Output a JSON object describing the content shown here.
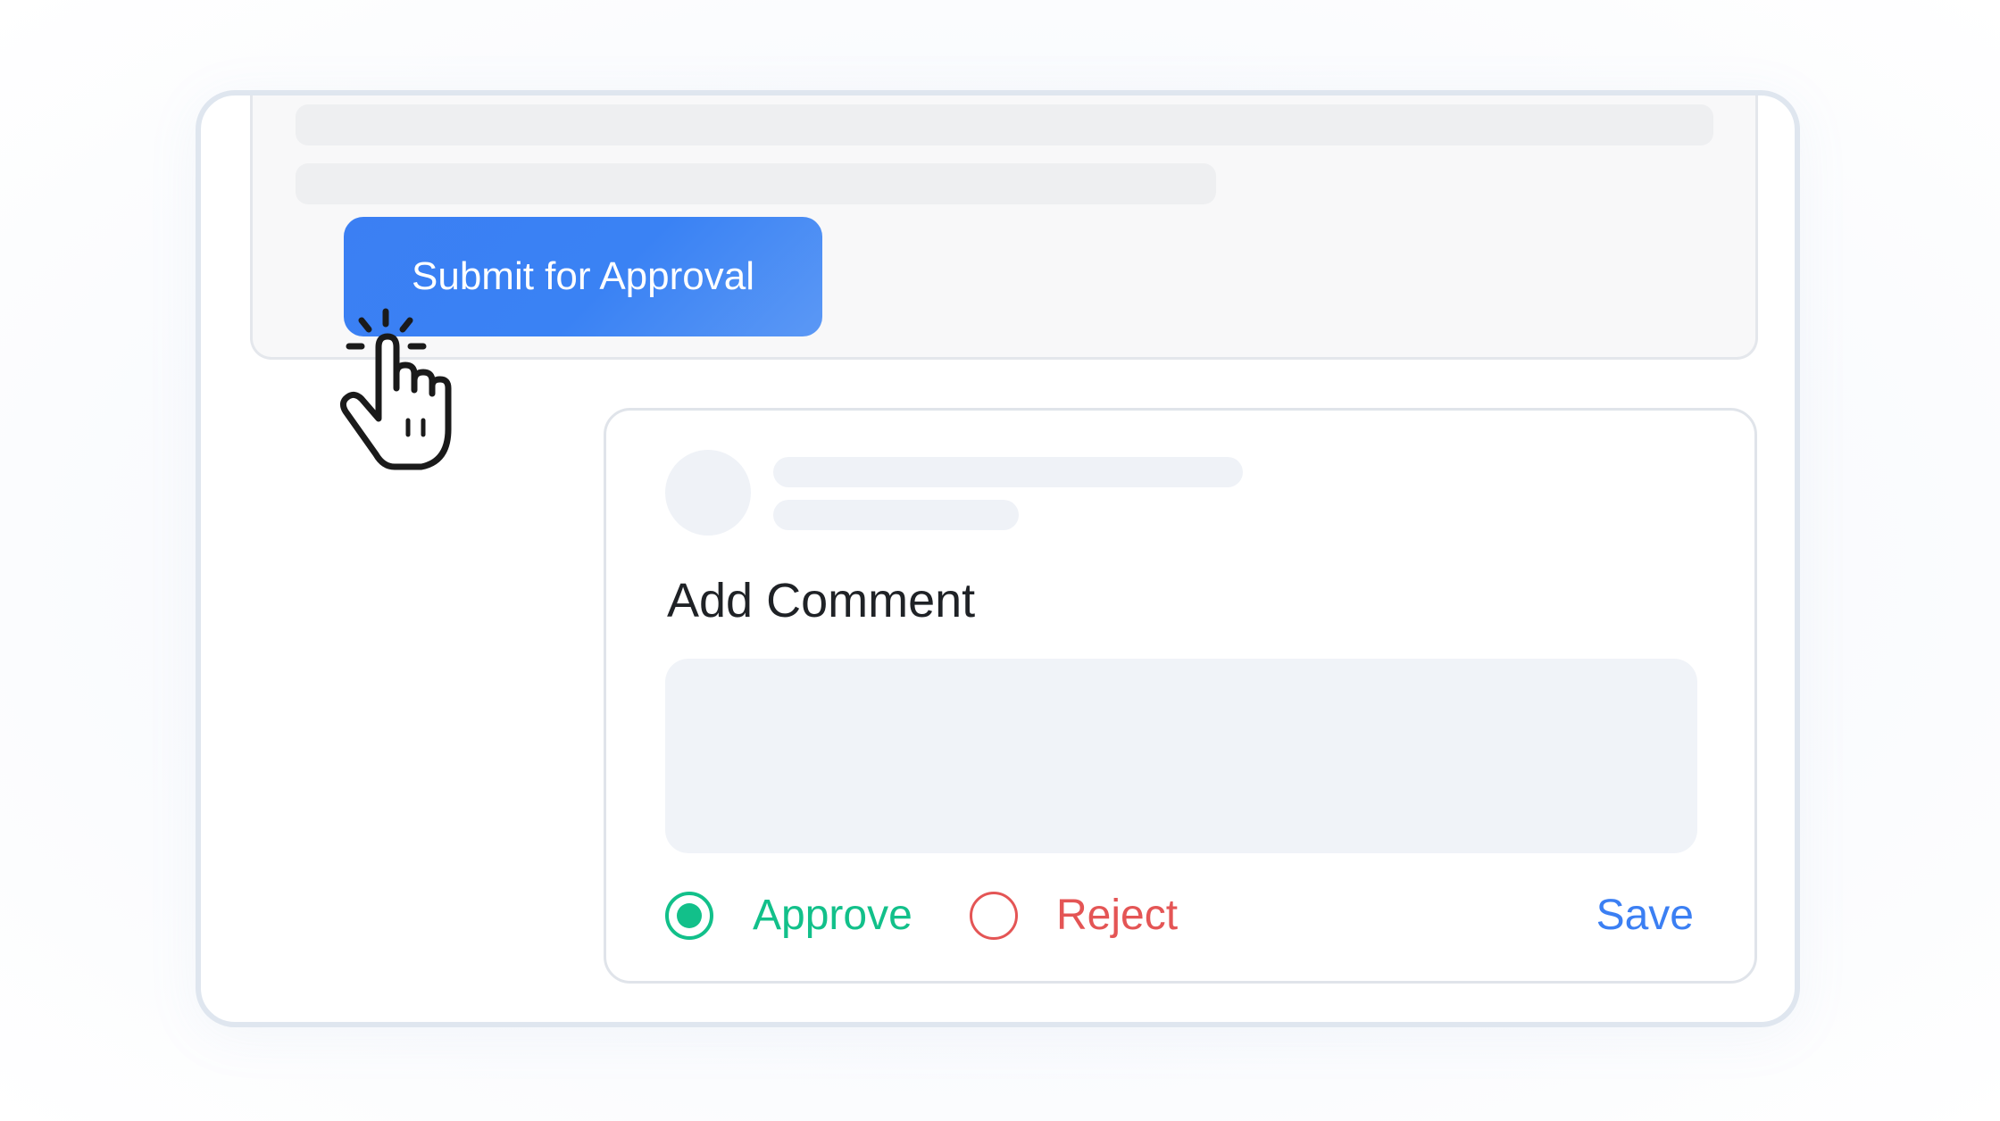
{
  "submit": {
    "label": "Submit for Approval"
  },
  "comment": {
    "title": "Add Comment",
    "input_value": "",
    "options": [
      {
        "label": "Approve",
        "selected": true,
        "color": "#12c08a"
      },
      {
        "label": "Reject",
        "selected": false,
        "color": "#e45555"
      }
    ],
    "save_label": "Save"
  },
  "colors": {
    "accent": "#3b7ff3",
    "approve": "#12c08a",
    "reject": "#e45555"
  },
  "icons": {
    "cursor": "hand-pointer-click-icon"
  }
}
